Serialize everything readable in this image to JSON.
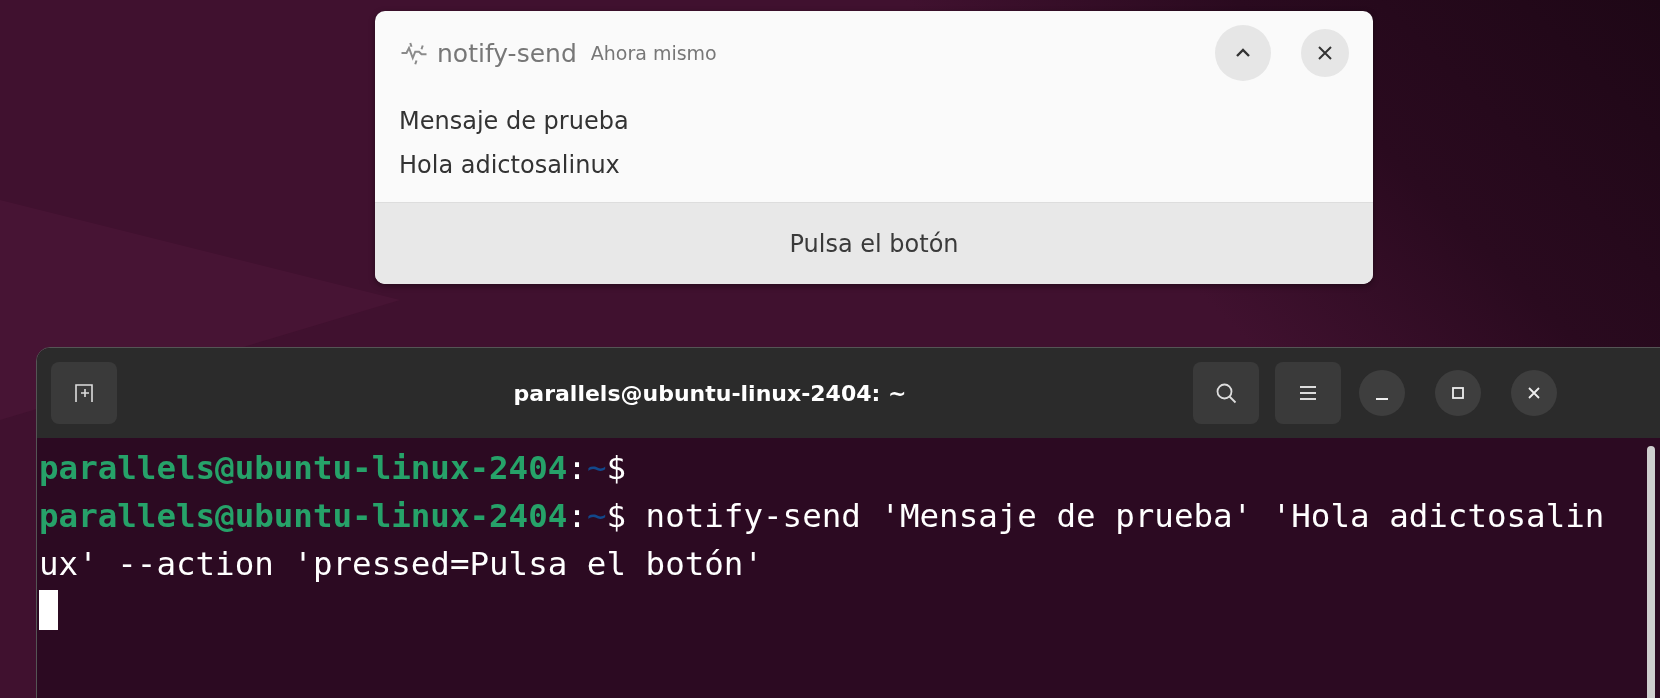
{
  "notification": {
    "app_name": "notify-send",
    "time": "Ahora mismo",
    "summary": "Mensaje de prueba",
    "body": "Hola adictosalinux",
    "actions": [
      "Pulsa el botón"
    ]
  },
  "terminal": {
    "title": "parallels@ubuntu-linux-2404: ~",
    "lines": [
      {
        "segments": [
          {
            "kind": "user",
            "text": "parallels@ubuntu-linux-2404"
          },
          {
            "kind": "plain",
            "text": ":"
          },
          {
            "kind": "path",
            "text": "~"
          },
          {
            "kind": "plain",
            "text": "$"
          }
        ]
      },
      {
        "segments": [
          {
            "kind": "user",
            "text": "parallels@ubuntu-linux-2404"
          },
          {
            "kind": "plain",
            "text": ":"
          },
          {
            "kind": "path",
            "text": "~"
          },
          {
            "kind": "plain",
            "text": "$ notify-send 'Mensaje de prueba' 'Hola adictosalin"
          }
        ]
      },
      {
        "segments": [
          {
            "kind": "plain",
            "text": "ux' --action 'pressed=Pulsa el botón'"
          }
        ]
      }
    ],
    "cursor": true
  }
}
